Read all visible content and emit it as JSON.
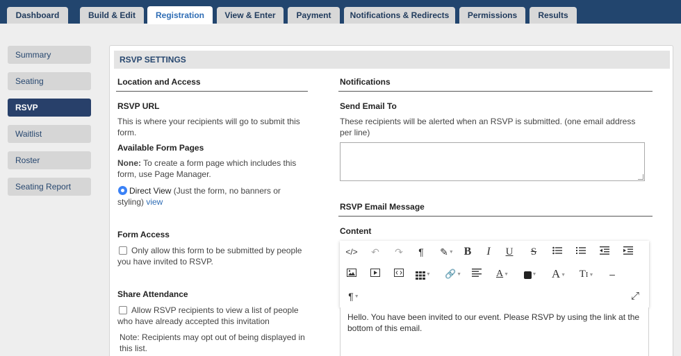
{
  "tabs": [
    {
      "label": "Dashboard"
    },
    {
      "label": "Build & Edit"
    },
    {
      "label": "Registration"
    },
    {
      "label": "View & Enter"
    },
    {
      "label": "Payment"
    },
    {
      "label": "Notifications & Redirects"
    },
    {
      "label": "Permissions"
    },
    {
      "label": "Results"
    }
  ],
  "sidebar": {
    "items": [
      {
        "label": "Summary"
      },
      {
        "label": "Seating"
      },
      {
        "label": "RSVP"
      },
      {
        "label": "Waitlist"
      },
      {
        "label": "Roster"
      },
      {
        "label": "Seating Report"
      }
    ]
  },
  "panel": {
    "title": "RSVP SETTINGS",
    "left": {
      "section_title": "Location and Access",
      "rsvp_url": {
        "label": "RSVP URL",
        "desc": "This is where your recipients will go to submit this form."
      },
      "form_pages": {
        "label": "Available Form Pages",
        "none_strong": "None:",
        "none_text": " To create a form page which includes this form, use Page Manager.",
        "direct_view_label": "Direct View",
        "direct_view_desc": " (Just the form, no banners or styling) ",
        "view_link": "view"
      },
      "form_access": {
        "label": "Form Access",
        "checkbox_label": "Only allow this form to be submitted by people you have invited to RSVP."
      },
      "share_attendance": {
        "label": "Share Attendance",
        "checkbox_label": "Allow RSVP recipients to view a list of people who have already accepted this invitation",
        "note": "Note: Recipients may opt out of being displayed in this list."
      }
    },
    "right": {
      "section_title": "Notifications",
      "send_email": {
        "label": "Send Email To",
        "desc": "These recipients will be alerted when an RSVP is submitted. (one email address per line)",
        "value": ""
      },
      "email_message": {
        "section_title": "RSVP Email Message",
        "content_label": "Content",
        "body": "Hello. You have been invited to our event. Please RSVP by using the link at the bottom of this email."
      }
    }
  },
  "colors": {
    "topbar": "#22456e",
    "tab_active_text": "#2f6db5",
    "nav_active": "#28406a",
    "radio": "#3b82f6"
  }
}
